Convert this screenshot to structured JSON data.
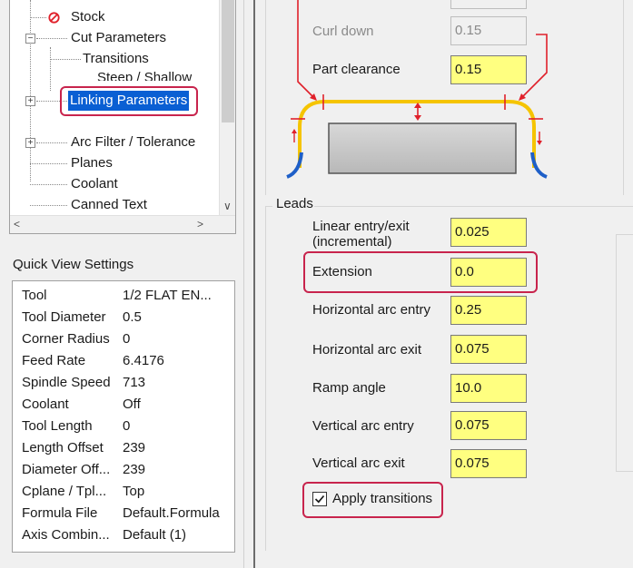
{
  "tree": {
    "items": [
      {
        "label": "Stock"
      },
      {
        "label": "Cut Parameters"
      },
      {
        "label": "Transitions"
      },
      {
        "label": "Steep / Shallow"
      },
      {
        "label": "Linking Parameters"
      },
      {
        "label": "Arc Filter / Tolerance"
      },
      {
        "label": "Planes"
      },
      {
        "label": "Coolant"
      },
      {
        "label": "Canned Text"
      }
    ]
  },
  "quick_view": {
    "title": "Quick View Settings",
    "rows": [
      {
        "key": "Tool",
        "value": "1/2 FLAT EN..."
      },
      {
        "key": "Tool Diameter",
        "value": "0.5"
      },
      {
        "key": "Corner Radius",
        "value": "0"
      },
      {
        "key": "Feed Rate",
        "value": "6.4176"
      },
      {
        "key": "Spindle Speed",
        "value": "713"
      },
      {
        "key": "Coolant",
        "value": "Off"
      },
      {
        "key": "Tool Length",
        "value": "0"
      },
      {
        "key": "Length Offset",
        "value": "239"
      },
      {
        "key": "Diameter Off...",
        "value": "239"
      },
      {
        "key": "Cplane / Tpl...",
        "value": "Top"
      },
      {
        "key": "Formula File",
        "value": "Default.Formula"
      },
      {
        "key": "Axis Combin...",
        "value": "Default (1)"
      }
    ]
  },
  "top_fields": {
    "curl_down_label": "Curl down",
    "curl_down_value": "0.15",
    "part_clearance_label": "Part clearance",
    "part_clearance_value": "0.15"
  },
  "leads": {
    "group_label": "Leads",
    "linear_label_1": "Linear entry/exit",
    "linear_label_2": "(incremental)",
    "linear_value": "0.025",
    "extension_label": "Extension",
    "extension_value": "0.0",
    "h_arc_entry_label": "Horizontal arc entry",
    "h_arc_entry_value": "0.25",
    "h_arc_exit_label": "Horizontal arc exit",
    "h_arc_exit_value": "0.075",
    "ramp_label": "Ramp angle",
    "ramp_value": "10.0",
    "v_arc_entry_label": "Vertical arc entry",
    "v_arc_entry_value": "0.075",
    "v_arc_exit_label": "Vertical arc exit",
    "v_arc_exit_value": "0.075",
    "apply_transitions_label": "Apply transitions",
    "apply_transitions_checked": true
  },
  "colors": {
    "callout": "#c8244d",
    "input_bg": "#ffff80",
    "path_yellow": "#f5c400",
    "arrow_red": "#e0202a",
    "lead_blue": "#1e5fc8"
  }
}
